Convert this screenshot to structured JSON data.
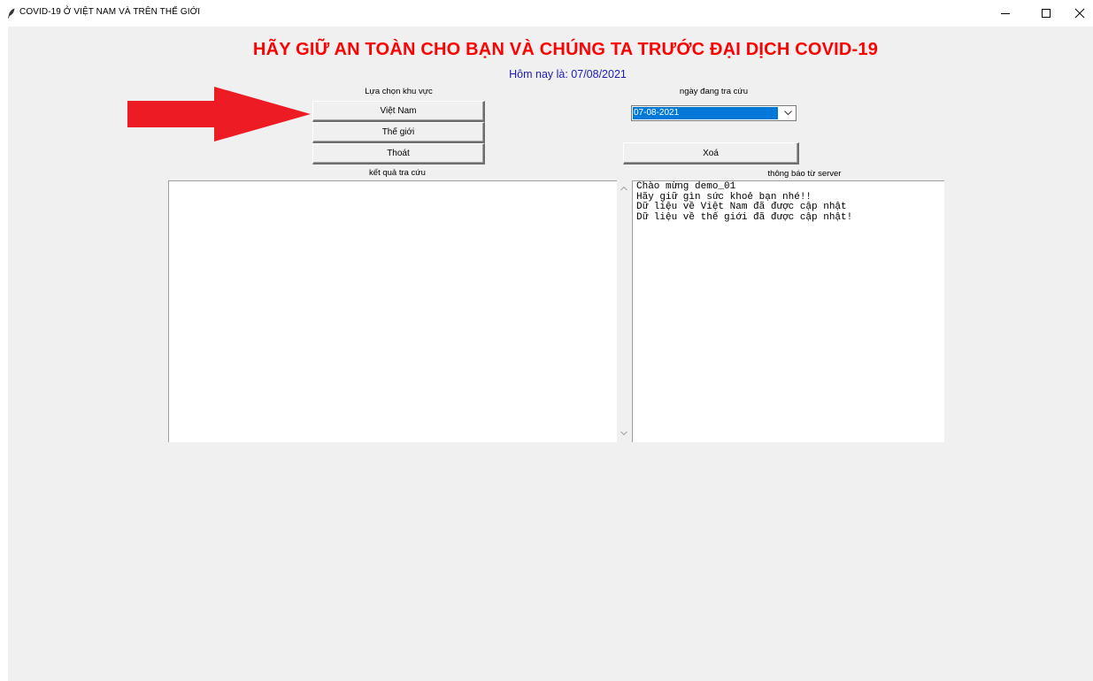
{
  "window": {
    "title": "COVID-19 Ở VIỆT NAM VÀ TRÊN THẾ GIỚI",
    "icon": "feather-icon",
    "controls": [
      "minimize-icon",
      "maximize-icon",
      "close-icon"
    ]
  },
  "header": {
    "title": "HÃY GIỮ AN TOÀN CHO BẠN VÀ CHÚNG TA TRƯỚC ĐẠI DỊCH COVID-19",
    "today": "Hôm nay là: 07/08/2021"
  },
  "region": {
    "label": "Lựa chọn khu vực",
    "buttons": {
      "vietnam": "Việt Nam",
      "world": "Thế giới",
      "exit": "Thoát"
    }
  },
  "date_lookup": {
    "label": "ngày đang tra cứu",
    "selected": "07-08-2021"
  },
  "clear_button": "Xoá",
  "results": {
    "label": "kết quả tra cứu",
    "content": ""
  },
  "server": {
    "label": "thông báo từ server",
    "messages": "Chào mừng demo_01\nHãy giữ gìn sức khoẻ bạn nhé!!\nDữ liệu về Việt Nam đã được cập nhật\nDữ liệu về thế giới đã được cập nhật!"
  },
  "annotation": {
    "arrow_color": "#ed1c24"
  },
  "colors": {
    "headline": "#ff0000",
    "today": "#1c1cb4",
    "selection": "#0078d7"
  }
}
